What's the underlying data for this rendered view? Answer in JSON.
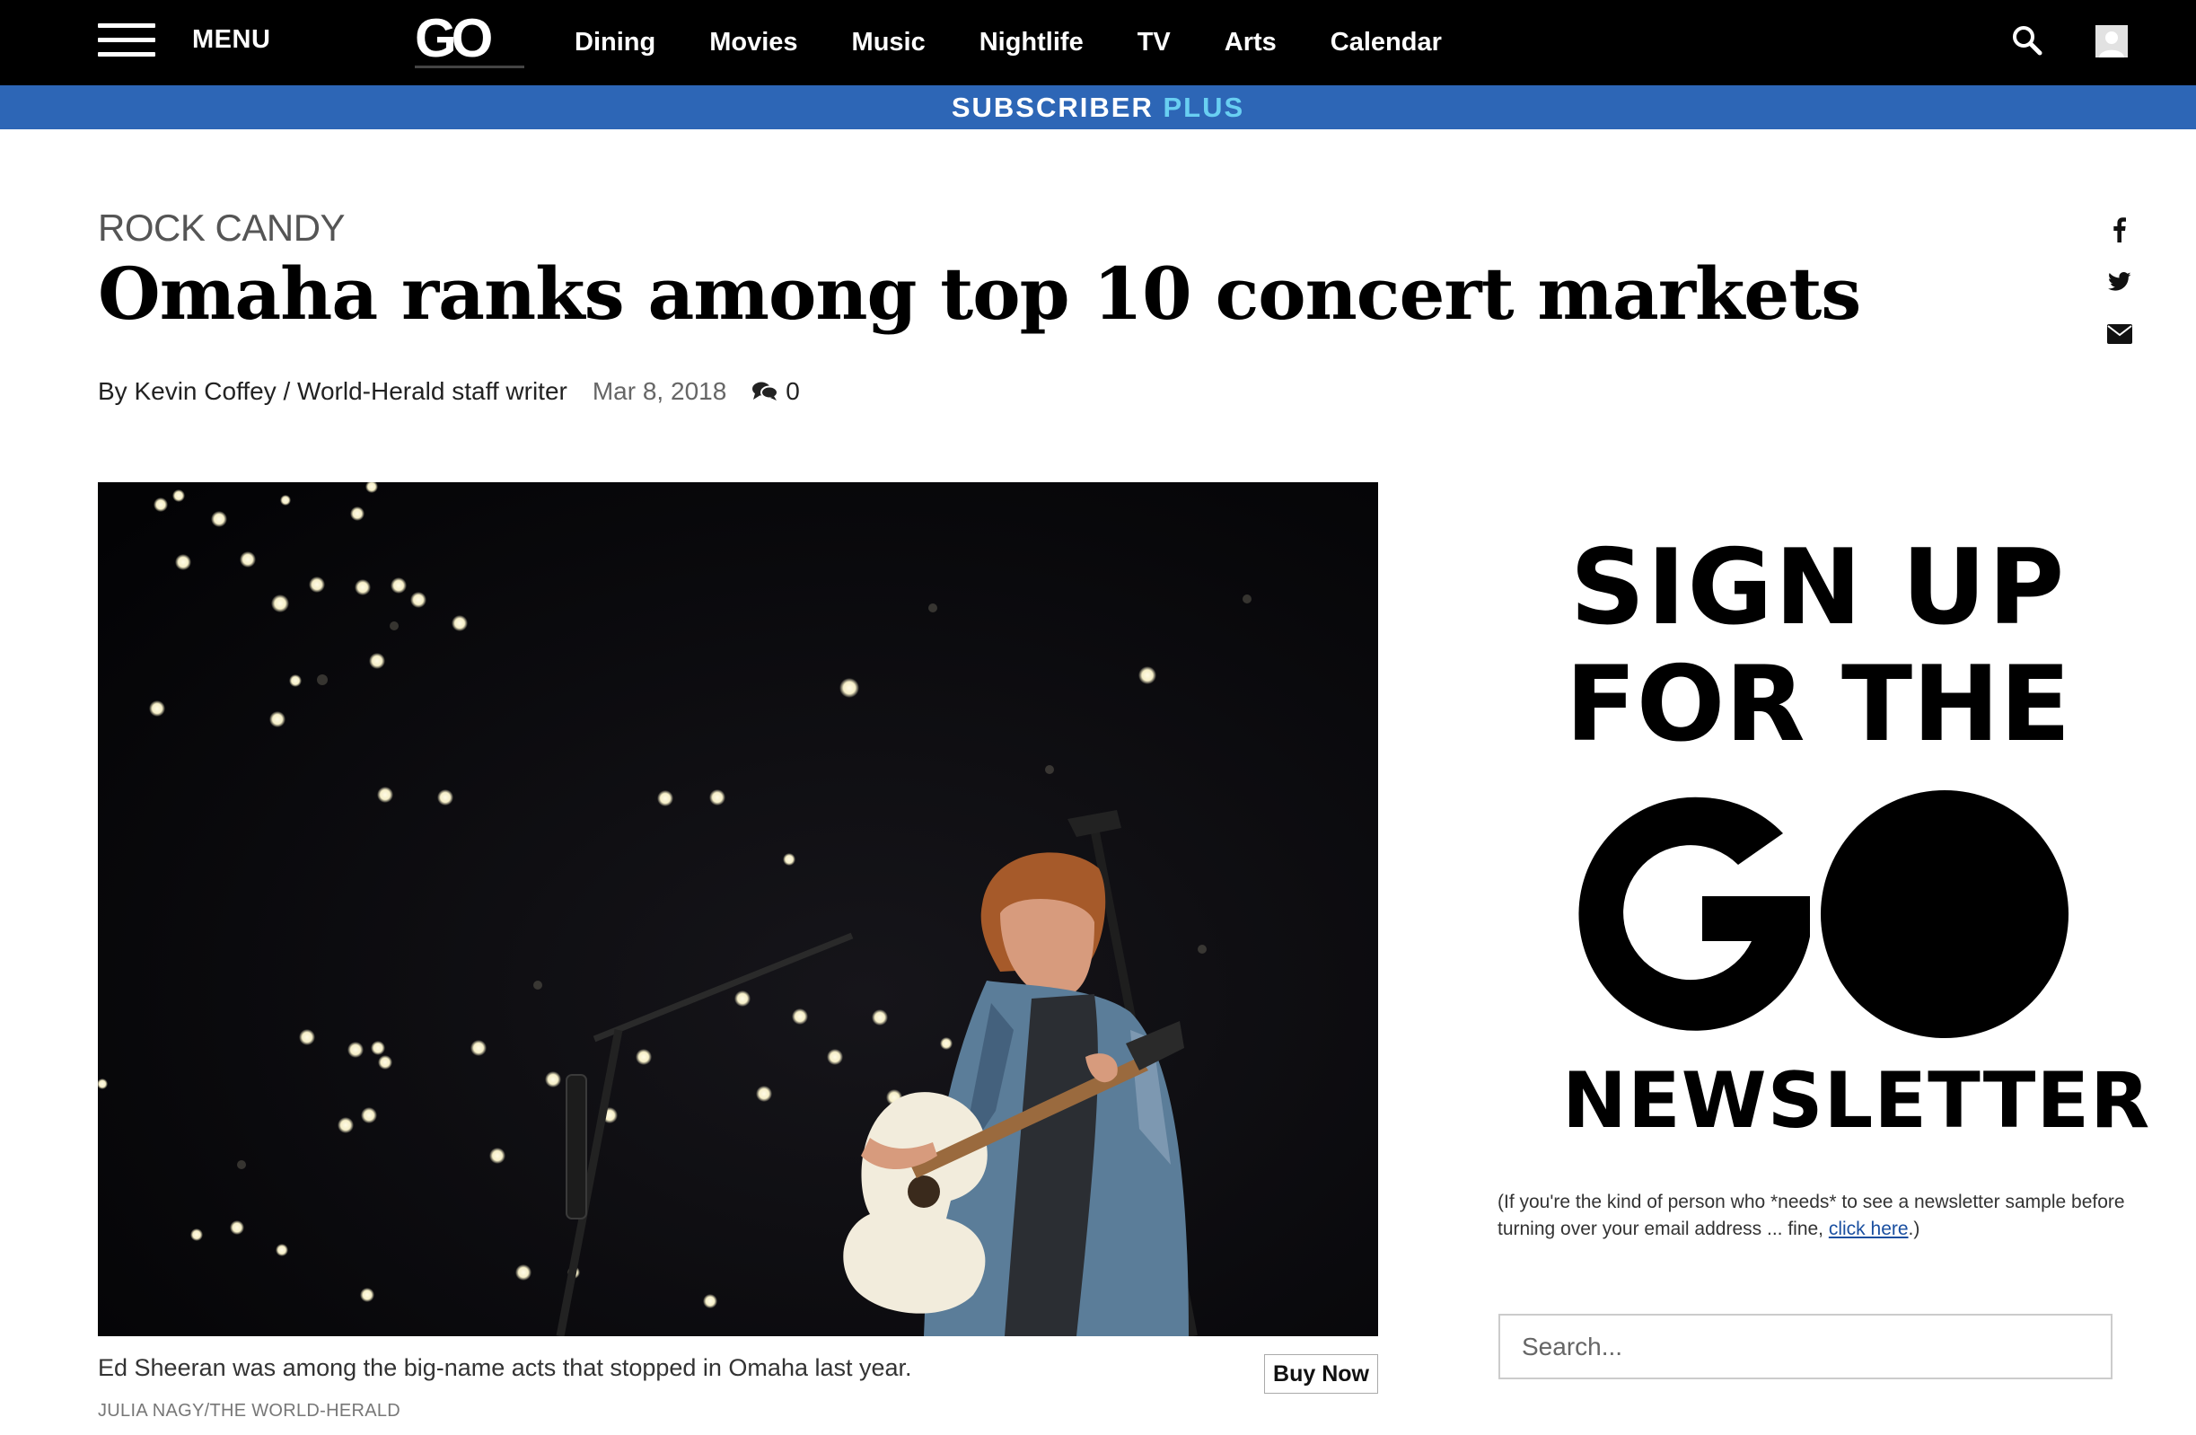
{
  "nav": {
    "menu_label": "MENU",
    "logo_text": "GO",
    "links": [
      "Dining",
      "Movies",
      "Music",
      "Nightlife",
      "TV",
      "Arts",
      "Calendar"
    ]
  },
  "subscriber_bar": {
    "part1": "SUBSCRIBER",
    "part2": "PLUS"
  },
  "article": {
    "kicker": "ROCK CANDY",
    "headline": "Omaha ranks among top 10 concert markets",
    "byline": "By Kevin Coffey / World-Herald staff writer",
    "date": "Mar 8, 2018",
    "comment_count": "0",
    "photo_caption": "Ed Sheeran was among the big-name acts that stopped in Omaha last year.",
    "photo_credit": "JULIA NAGY/THE WORLD-HERALD",
    "buy_now_label": "Buy Now"
  },
  "share_icons": [
    "facebook-icon",
    "twitter-icon",
    "email-icon"
  ],
  "sidebar": {
    "newsletter_line1": "SIGN UP",
    "newsletter_line2": "FOR THE",
    "newsletter_logo": "GO",
    "newsletter_line4": "NEWSLETTER",
    "sample_note_before": "(If you're the kind of person who *needs* to see a newsletter sample before turning over your email address ... fine, ",
    "sample_note_link": "click here",
    "sample_note_after": ".)",
    "search_placeholder": "Search..."
  },
  "colors": {
    "nav_background": "#000000",
    "subscriber_bar": "#2d66b6",
    "subscriber_plus": "#69cff2",
    "link": "#1a4fa0"
  }
}
